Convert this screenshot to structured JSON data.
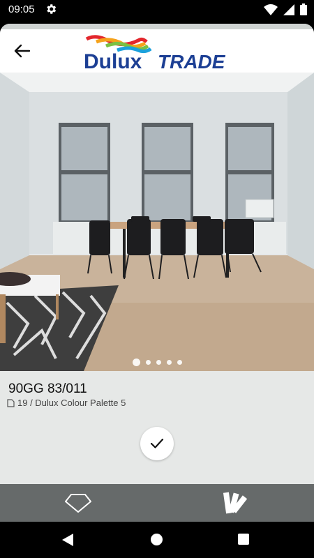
{
  "statusbar": {
    "time": "09:05"
  },
  "header": {
    "logo_text_main": "Dulux",
    "logo_text_trade": "TRADE"
  },
  "carousel": {
    "total": 5,
    "active_index": 0
  },
  "colour": {
    "code": "90GG 83/011",
    "palette": "19 / Dulux Colour Palette 5"
  },
  "colors": {
    "sheet_bg": "#e6e8e7",
    "bottom_nav": "#666a6a",
    "brand_blue": "#1c3f94"
  },
  "icons": {
    "back": "arrow-left-icon",
    "confirm": "check-icon",
    "nav_left": "diamond-shape-icon",
    "nav_right": "colour-fan-deck-icon"
  }
}
